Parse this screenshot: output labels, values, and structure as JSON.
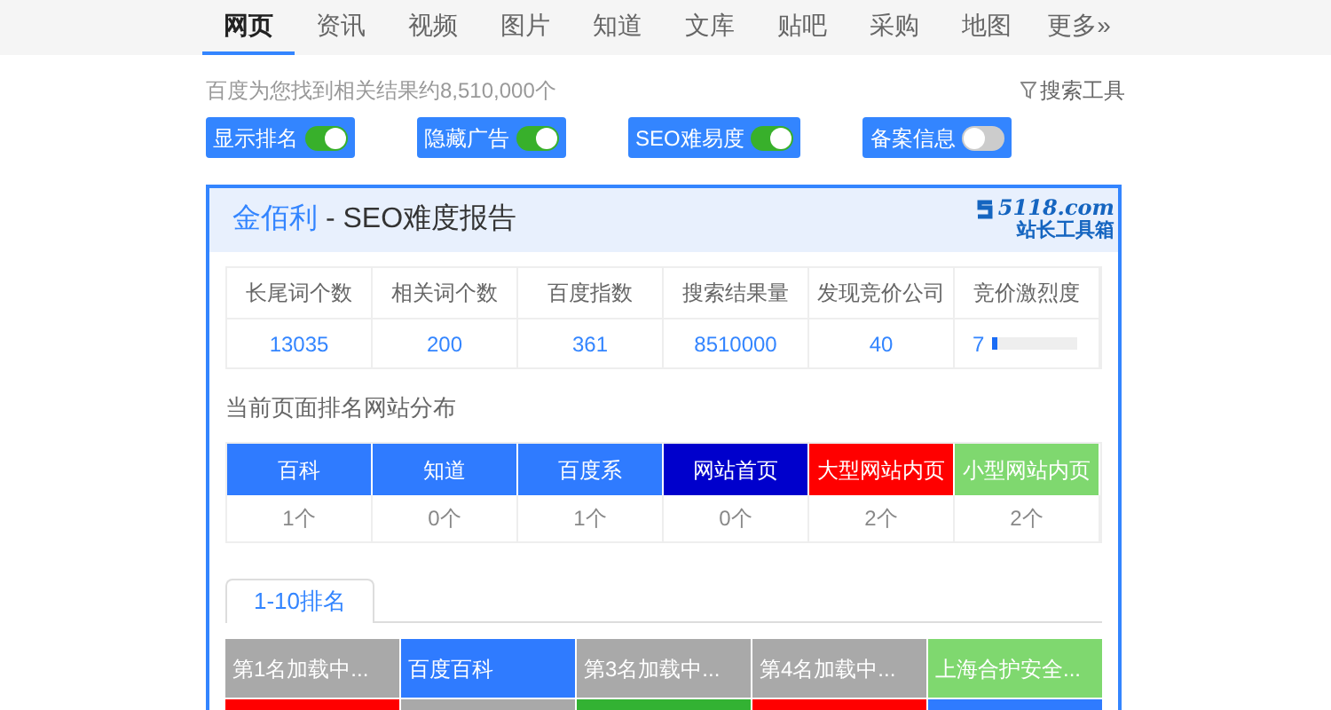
{
  "nav": [
    {
      "label": "网页",
      "selected": true
    },
    {
      "label": "资讯",
      "selected": false
    },
    {
      "label": "视频",
      "selected": false
    },
    {
      "label": "图片",
      "selected": false
    },
    {
      "label": "知道",
      "selected": false
    },
    {
      "label": "文库",
      "selected": false
    },
    {
      "label": "贴吧",
      "selected": false
    },
    {
      "label": "采购",
      "selected": false
    },
    {
      "label": "地图",
      "selected": false
    },
    {
      "label": "更多»",
      "selected": false
    }
  ],
  "result_count": "百度为您找到相关结果约8,510,000个",
  "search_tools": "搜索工具",
  "toggles": [
    {
      "label": "显示排名",
      "on": true
    },
    {
      "label": "隐藏广告",
      "on": true
    },
    {
      "label": "SEO难易度",
      "on": true
    },
    {
      "label": "备案信息",
      "on": false
    }
  ],
  "report": {
    "keyword": "金佰利",
    "title": " - SEO难度报告",
    "logo_domain": "5118.com",
    "logo_subtitle": "站长工具箱",
    "stats": [
      {
        "label": "长尾词个数",
        "value": "13035"
      },
      {
        "label": "相关词个数",
        "value": "200"
      },
      {
        "label": "百度指数",
        "value": "361"
      },
      {
        "label": "搜索结果量",
        "value": "8510000"
      },
      {
        "label": "发现竞价公司",
        "value": "40"
      },
      {
        "label": "竞价激烈度",
        "value": "7",
        "level": 0.07
      }
    ],
    "distribution_title": "当前页面排名网站分布",
    "distribution": [
      {
        "label": "百科",
        "count": "1个",
        "color": "#2f7bff"
      },
      {
        "label": "知道",
        "count": "0个",
        "color": "#2f7bff"
      },
      {
        "label": "百度系",
        "count": "1个",
        "color": "#2f7bff"
      },
      {
        "label": "网站首页",
        "count": "0个",
        "color": "#0000cc"
      },
      {
        "label": "大型网站内页",
        "count": "2个",
        "color": "#ff0000"
      },
      {
        "label": "小型网站内页",
        "count": "2个",
        "color": "#7fd86f"
      }
    ],
    "tab": "1-10排名",
    "rankings": [
      {
        "label": "第1名加载中...",
        "color": "#a9a9a9"
      },
      {
        "label": "百度百科",
        "color": "#2f7bff"
      },
      {
        "label": "第3名加载中...",
        "color": "#a9a9a9"
      },
      {
        "label": "第4名加载中...",
        "color": "#a9a9a9"
      },
      {
        "label": "上海合护安全...",
        "color": "#7fd86f"
      },
      {
        "color": "#ff0000"
      },
      {
        "color": "#a9a9a9"
      },
      {
        "color": "#33b233"
      },
      {
        "color": "#ff0000"
      },
      {
        "color": "#2f7bff"
      }
    ]
  }
}
